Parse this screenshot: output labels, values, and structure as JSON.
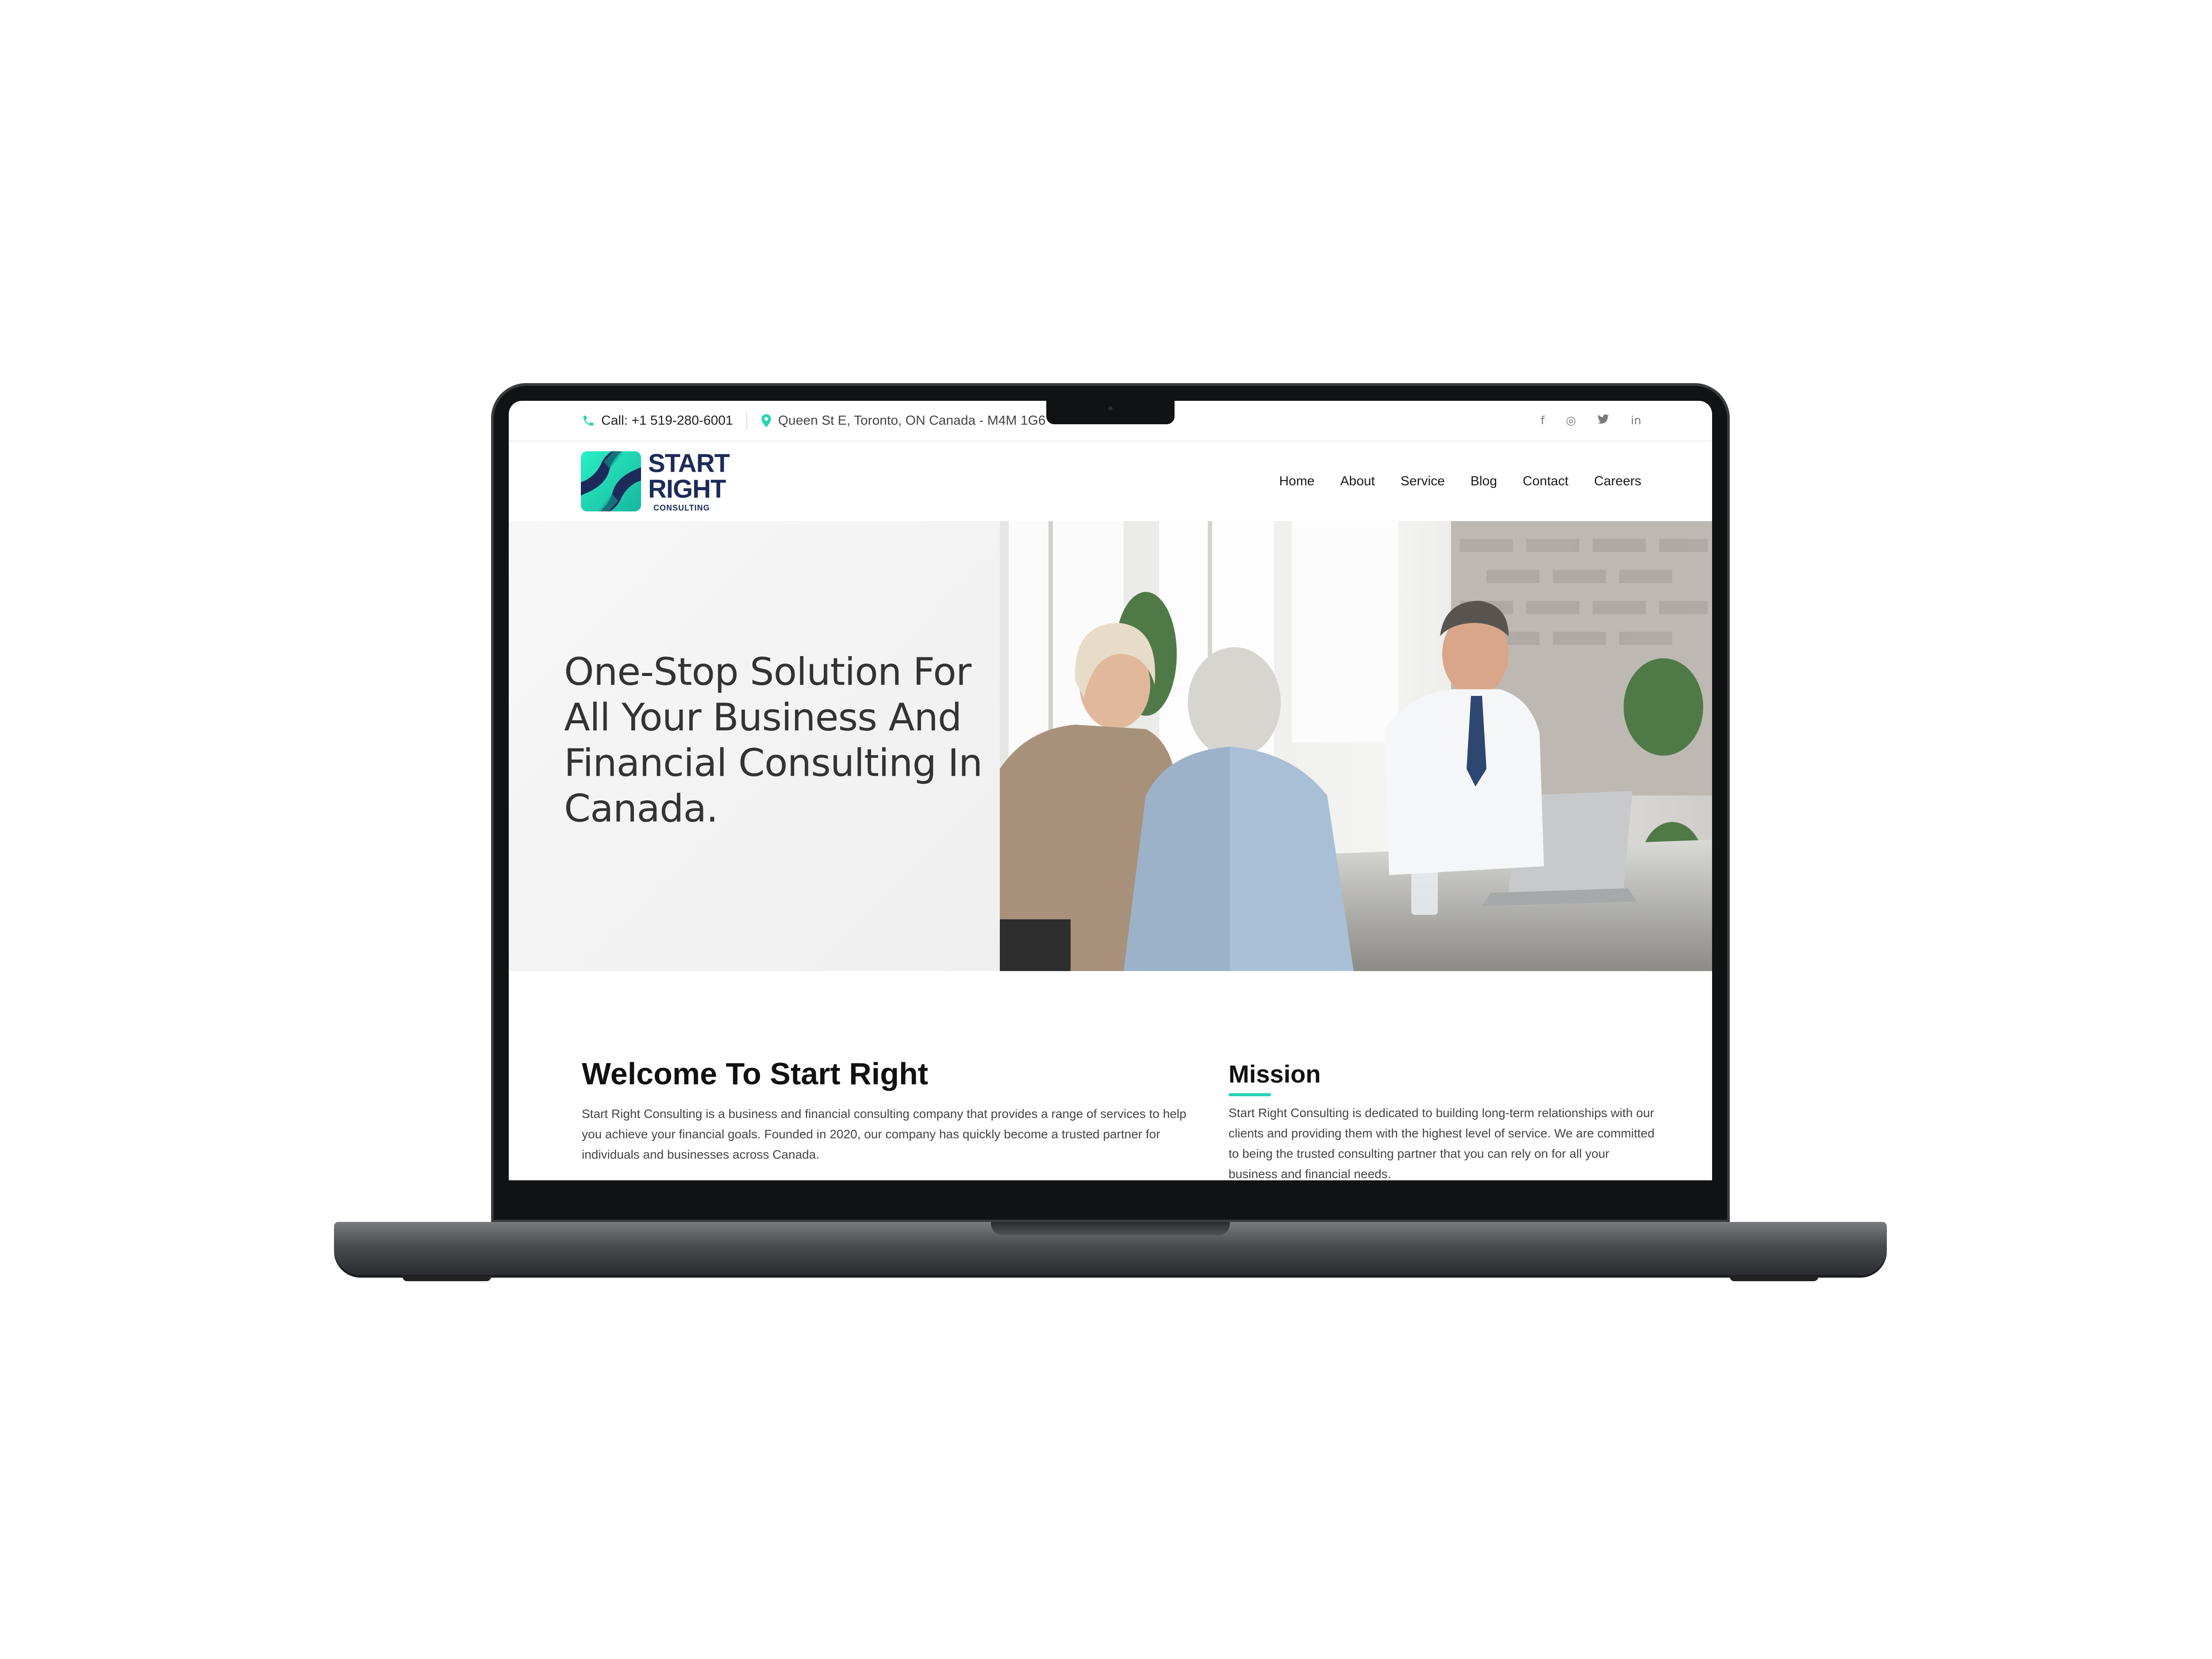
{
  "topbar": {
    "phone_text": "Call: +1 519-280-6001",
    "address_text": "Queen St E, Toronto, ON Canada - M4M 1G6",
    "social_icons": [
      "facebook-icon",
      "instagram-icon",
      "twitter-icon",
      "linkedin-icon"
    ],
    "social_glyphs": {
      "facebook": "f",
      "instagram": "◎",
      "twitter": "🐦",
      "linkedin": "in"
    }
  },
  "logo": {
    "line1": "START",
    "line2": "RIGHT",
    "line3": "CONSULTING"
  },
  "nav": {
    "items": [
      "Home",
      "About",
      "Service",
      "Blog",
      "Contact",
      "Careers"
    ]
  },
  "hero": {
    "title": "One-Stop Solution For All Your Business And Financial Consulting In Canada."
  },
  "welcome": {
    "title": "Welcome To Start Right",
    "text": "Start Right Consulting is a business and financial consulting company that provides a range of services to help you achieve your financial goals. Founded in 2020, our company has quickly become a trusted partner for individuals and businesses across Canada."
  },
  "mission": {
    "title": "Mission",
    "text": "Start Right Consulting is dedicated to building long-term relationships with our clients and providing them with the highest level of service. We are committed to being the trusted consulting partner that you can rely on for all your business and financial needs."
  },
  "colors": {
    "accent": "#24d5b4",
    "brand_navy": "#1d2b5a",
    "text_dark": "#111111"
  }
}
